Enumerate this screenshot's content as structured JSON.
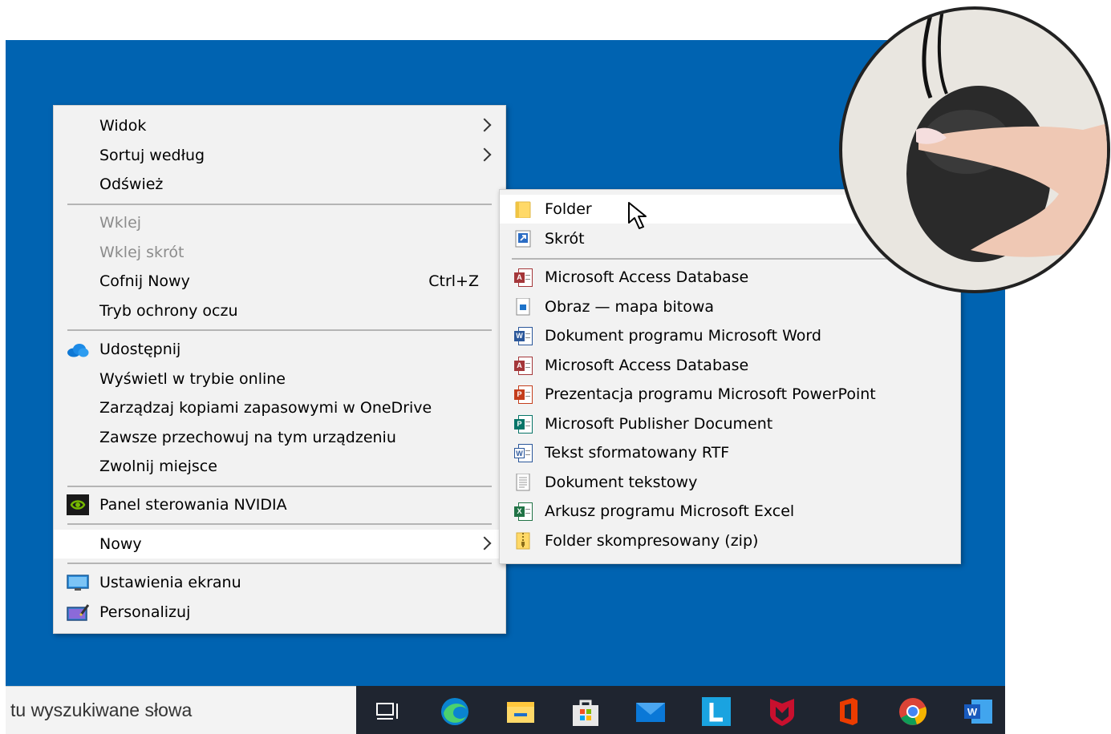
{
  "context_menu": {
    "items": [
      {
        "label": "Widok",
        "has_submenu": true
      },
      {
        "label": "Sortuj według",
        "has_submenu": true
      },
      {
        "label": "Odśwież"
      },
      {
        "label": "Wklej",
        "disabled": true
      },
      {
        "label": "Wklej skrót",
        "disabled": true
      },
      {
        "label": "Cofnij Nowy",
        "shortcut": "Ctrl+Z"
      },
      {
        "label": "Tryb ochrony oczu"
      },
      {
        "label": "Udostępnij",
        "icon": "onedrive-cloud-icon"
      },
      {
        "label": "Wyświetl w trybie online"
      },
      {
        "label": "Zarządzaj kopiami zapasowymi w OneDrive"
      },
      {
        "label": "Zawsze przechowuj na tym urządzeniu"
      },
      {
        "label": "Zwolnij miejsce"
      },
      {
        "label": "Panel sterowania NVIDIA",
        "icon": "nvidia-icon"
      },
      {
        "label": "Nowy",
        "has_submenu": true,
        "highlighted": true
      },
      {
        "label": "Ustawienia ekranu",
        "icon": "display-settings-icon"
      },
      {
        "label": "Personalizuj",
        "icon": "personalize-icon"
      }
    ]
  },
  "submenu": {
    "items": [
      {
        "label": "Folder",
        "icon": "folder-icon",
        "highlighted": true
      },
      {
        "label": "Skrót",
        "icon": "shortcut-icon"
      },
      {
        "label": "Microsoft Access Database",
        "icon": "access-icon"
      },
      {
        "label": "Obraz — mapa bitowa",
        "icon": "bitmap-icon"
      },
      {
        "label": "Dokument programu Microsoft Word",
        "icon": "word-doc-icon"
      },
      {
        "label": "Microsoft Access Database",
        "icon": "access-icon"
      },
      {
        "label": "Prezentacja programu Microsoft PowerPoint",
        "icon": "powerpoint-icon"
      },
      {
        "label": "Microsoft Publisher Document",
        "icon": "publisher-icon"
      },
      {
        "label": "Tekst sformatowany RTF",
        "icon": "rtf-icon"
      },
      {
        "label": "Dokument tekstowy",
        "icon": "text-doc-icon"
      },
      {
        "label": "Arkusz programu Microsoft Excel",
        "icon": "excel-icon"
      },
      {
        "label": "Folder skompresowany (zip)",
        "icon": "zip-folder-icon"
      }
    ]
  },
  "taskbar": {
    "search_text": "tu wyszukiwane słowa",
    "icons": [
      "task-view-icon",
      "edge-icon",
      "file-explorer-icon",
      "store-icon",
      "mail-icon",
      "l-app-icon",
      "mcafee-icon",
      "office-icon",
      "chrome-icon",
      "word-icon"
    ]
  },
  "colors": {
    "desktop": "#0063b1",
    "menu_bg": "#f2f2f2",
    "taskbar": "#1f2530"
  }
}
